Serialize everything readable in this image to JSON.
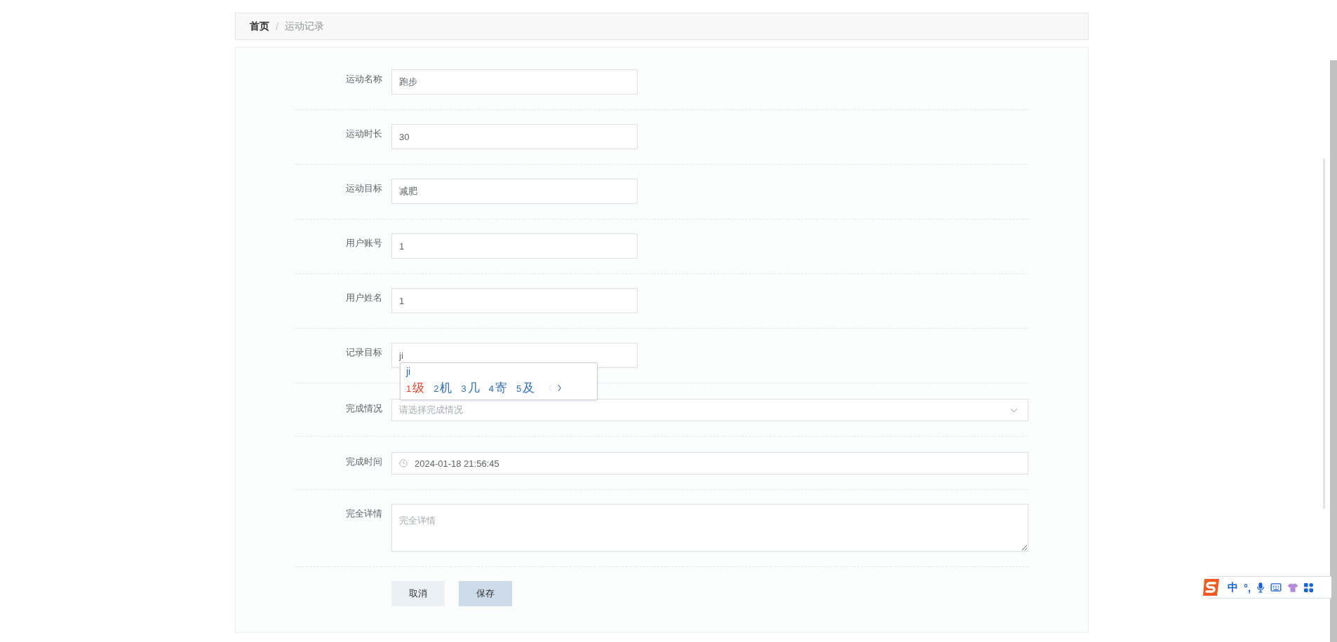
{
  "breadcrumb": {
    "separator": "/",
    "items": [
      {
        "label": "首页",
        "current": false
      },
      {
        "label": "运动记录",
        "current": true
      }
    ]
  },
  "form": {
    "fields": [
      {
        "kind": "text",
        "label": "运动名称",
        "value": "跑步"
      },
      {
        "kind": "text",
        "label": "运动时长",
        "value": "30"
      },
      {
        "kind": "text",
        "label": "运动目标",
        "value": "减肥"
      },
      {
        "kind": "text",
        "label": "用户账号",
        "value": "1"
      },
      {
        "kind": "text",
        "label": "用户姓名",
        "value": "1"
      },
      {
        "kind": "text",
        "label": "记录目标",
        "value": "ji"
      },
      {
        "kind": "select",
        "label": "完成情况",
        "placeholder": "请选择完成情况"
      },
      {
        "kind": "datetime",
        "label": "完成时间",
        "value": "2024-01-18 21:56:45"
      },
      {
        "kind": "textarea",
        "label": "完全详情",
        "placeholder": "完全详情"
      }
    ],
    "buttons": [
      {
        "kind": "cancel",
        "label": "取消"
      },
      {
        "kind": "save",
        "label": "保存"
      }
    ]
  },
  "ime_popup": {
    "composition": "ji",
    "candidates": [
      {
        "number": "1",
        "text": "级",
        "selected": true
      },
      {
        "number": "2",
        "text": "机",
        "selected": false
      },
      {
        "number": "3",
        "text": "几",
        "selected": false
      },
      {
        "number": "4",
        "text": "寄",
        "selected": false
      },
      {
        "number": "5",
        "text": "及",
        "selected": false
      }
    ]
  },
  "ime_toolbar": {
    "mode": "中",
    "punctuation": "°,"
  }
}
